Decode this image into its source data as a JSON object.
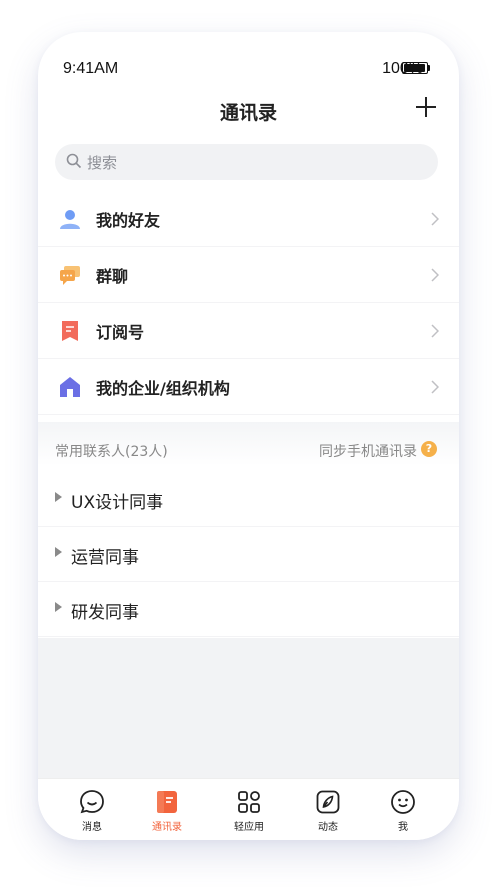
{
  "status_bar": {
    "time": "9:41AM",
    "battery": "100%"
  },
  "header": {
    "title": "通讯录"
  },
  "search": {
    "placeholder": "搜索"
  },
  "menu": [
    {
      "label": "我的好友",
      "icon": "user-icon",
      "color": "#6f9cf5"
    },
    {
      "label": "群聊",
      "icon": "chat-group-icon",
      "color": "#f5a54a"
    },
    {
      "label": "订阅号",
      "icon": "bookmark-icon",
      "color": "#f26b5b"
    },
    {
      "label": "我的企业/组织机构",
      "icon": "house-icon",
      "color": "#6b6fe5"
    }
  ],
  "contacts_section": {
    "title": "常用联系人(23人)",
    "sync_label": "同步手机通讯录",
    "help_symbol": "?"
  },
  "groups": [
    {
      "label": "UX设计同事"
    },
    {
      "label": "运营同事"
    },
    {
      "label": "研发同事"
    }
  ],
  "tabs": [
    {
      "label": "消息",
      "icon": "message-icon"
    },
    {
      "label": "通讯录",
      "icon": "contacts-icon",
      "active": true
    },
    {
      "label": "轻应用",
      "icon": "apps-grid-icon"
    },
    {
      "label": "动态",
      "icon": "compass-icon"
    },
    {
      "label": "我",
      "icon": "smiley-icon"
    }
  ],
  "colors": {
    "accent": "#f2643d",
    "background": "#f2f3f5"
  }
}
